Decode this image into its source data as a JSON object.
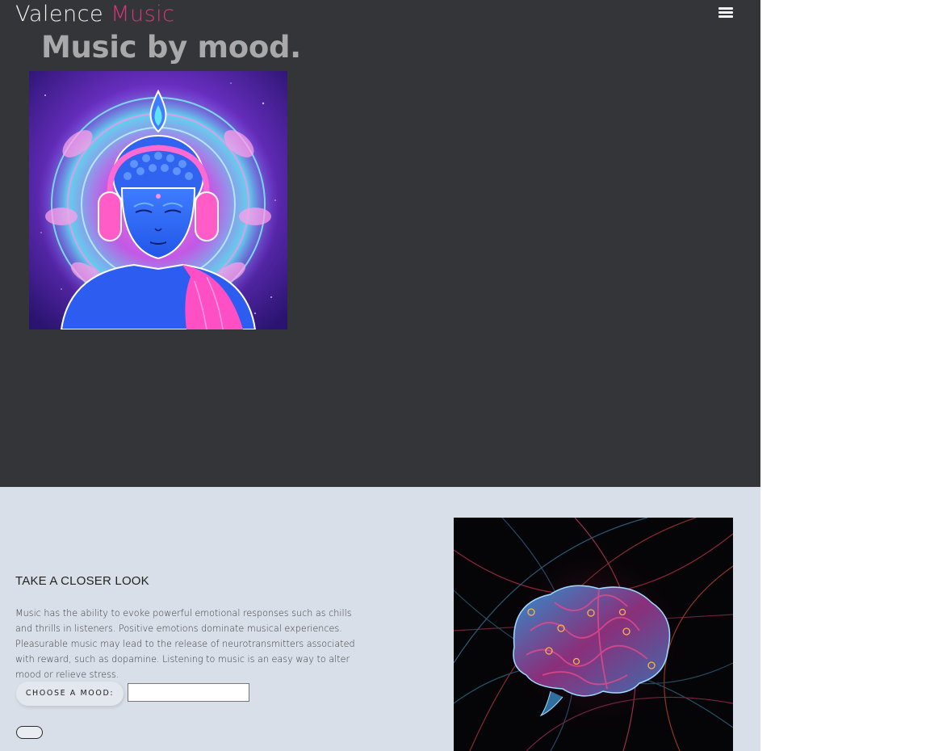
{
  "header": {
    "brand_part1": "Valence",
    "brand_part2": "Music",
    "menu_icon": "hamburger-menu-icon"
  },
  "hero": {
    "tagline": "Music by mood.",
    "image_subject": "blue buddha with pink headphones and mandala"
  },
  "section": {
    "title": "TAKE A CLOSER LOOK",
    "body": "Music has the ability to evoke powerful emotional responses such as chills and thrills in listeners. Positive emotions dominate musical experiences. Pleasurable music may lead to the release of neurotransmitters associated with reward, such as dopamine. Listening to music is an easy way to alter mood or relieve stress.",
    "mood_label": "CHOOSE A MOOD:",
    "mood_value": "",
    "submit_label": "",
    "image_subject": "glowing brain with neural threads"
  },
  "colors": {
    "hero_bg": "#343538",
    "accent": "#d6367f",
    "lower_bg": "#d9dfe9",
    "tagline": "#a9a9ab"
  }
}
